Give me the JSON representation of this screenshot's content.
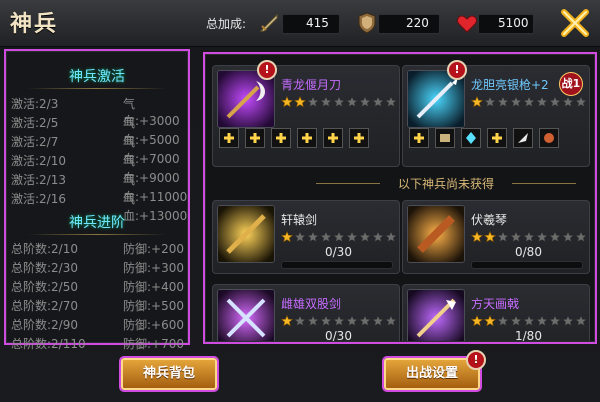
{
  "header": {
    "title": "神兵",
    "bonus_label": "总加成:",
    "stats": [
      {
        "icon": "sword-icon",
        "value": "415"
      },
      {
        "icon": "shield-icon",
        "value": "220"
      },
      {
        "icon": "heart-icon",
        "value": "5100"
      }
    ],
    "close_icon": "close-icon"
  },
  "left_panel": {
    "activation_title": "神兵激活",
    "activation_rows": [
      {
        "left": "激活:2/3",
        "right": "气血:+3000"
      },
      {
        "left": "激活:2/5",
        "right": "气血:+5000"
      },
      {
        "left": "激活:2/7",
        "right": "气血:+7000"
      },
      {
        "left": "激活:2/10",
        "right": "气血:+9000"
      },
      {
        "left": "激活:2/13",
        "right": "气血:+11000"
      },
      {
        "left": "激活:2/16",
        "right": "气血:+13000"
      }
    ],
    "advance_title": "神兵进阶",
    "advance_rows": [
      {
        "left": "总阶数:2/10",
        "right": "防御:+200"
      },
      {
        "left": "总阶数:2/30",
        "right": "防御:+300"
      },
      {
        "left": "总阶数:2/50",
        "right": "防御:+400"
      },
      {
        "left": "总阶数:2/70",
        "right": "防御:+500"
      },
      {
        "left": "总阶数:2/90",
        "right": "防御:+600"
      },
      {
        "left": "总阶数:2/110",
        "right": "防御:+700"
      }
    ]
  },
  "weapons_owned": [
    {
      "name": "青龙偃月刀",
      "stars_filled": 2,
      "stars_total": 9,
      "warning": "!"
    },
    {
      "name": "龙胆亮银枪+2",
      "stars_filled": 1,
      "stars_total": 9,
      "warning": "!",
      "battle_badge": "战1"
    }
  ],
  "divider_text": "以下神兵尚未获得",
  "weapons_locked": [
    {
      "name": "轩辕剑",
      "stars_filled": 1,
      "stars_total": 9,
      "progress_text": "0/30",
      "progress_fraction": 0.0
    },
    {
      "name": "伏羲琴",
      "stars_filled": 2,
      "stars_total": 9,
      "progress_text": "0/80",
      "progress_fraction": 0.0
    },
    {
      "name": "雌雄双股剑",
      "stars_filled": 1,
      "stars_total": 9,
      "progress_text": "0/30",
      "progress_fraction": 0.0
    },
    {
      "name": "方天画戟",
      "stars_filled": 2,
      "stars_total": 9,
      "progress_text": "1/80",
      "progress_fraction": 0.0125
    }
  ],
  "buttons": {
    "bag": "神兵背包",
    "battle": "出战设置",
    "battle_warning": "!"
  },
  "colors": {
    "accent_purple": "#d04be0",
    "cyan_title": "#6fe3ff",
    "button_gold": "#e3a43a"
  }
}
